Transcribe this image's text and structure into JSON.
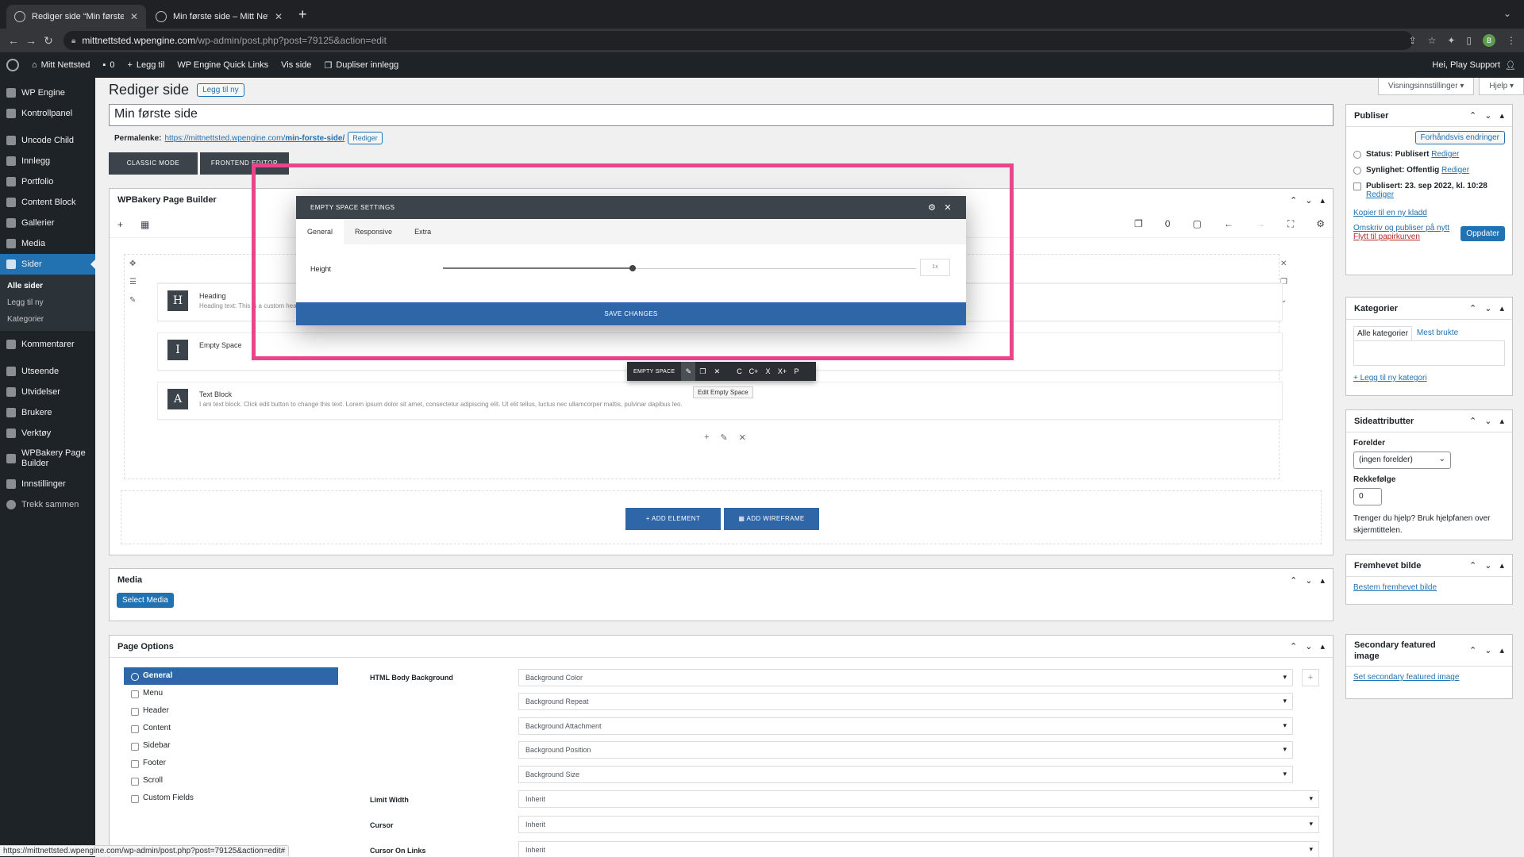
{
  "browser": {
    "tabs": [
      {
        "label": "Rediger side “Min første side”"
      },
      {
        "label": "Min første side – Mitt Nettsted"
      }
    ],
    "url_host": "mittnettsted.wpengine.com",
    "url_path": "/wp-admin/post.php?post=79125&action=edit",
    "profile_initial": "B"
  },
  "adminbar": {
    "site": "Mitt Nettsted",
    "comments": "0",
    "new": "Legg til",
    "quicklinks": "WP Engine Quick Links",
    "view": "Vis side",
    "duplicate": "Dupliser innlegg",
    "greeting": "Hei, Play Support"
  },
  "sidebar": {
    "items": [
      {
        "label": "WP Engine"
      },
      {
        "label": "Kontrollpanel"
      },
      {
        "label": "Uncode Child"
      },
      {
        "label": "Innlegg"
      },
      {
        "label": "Portfolio"
      },
      {
        "label": "Content Block"
      },
      {
        "label": "Gallerier"
      },
      {
        "label": "Media"
      },
      {
        "label": "Sider"
      }
    ],
    "sub": [
      "Alle sider",
      "Legg til ny",
      "Kategorier"
    ],
    "items2": [
      {
        "label": "Kommentarer"
      },
      {
        "label": "Utseende"
      },
      {
        "label": "Utvidelser"
      },
      {
        "label": "Brukere"
      },
      {
        "label": "Verktøy"
      },
      {
        "label": "WPBakery Page Builder"
      },
      {
        "label": "Innstillinger"
      },
      {
        "label": "Trekk sammen"
      }
    ]
  },
  "header": {
    "title": "Rediger side",
    "add_new": "Legg til ny",
    "screen_options": "Visningsinnstillinger",
    "help": "Hjelp"
  },
  "post": {
    "title": "Min første side",
    "permalink_label": "Permalenke:",
    "permalink_base": "https://mittnettsted.wpengine.com/",
    "permalink_slug": "min-forste-side/",
    "edit": "Rediger"
  },
  "modes": {
    "classic": "CLASSIC MODE",
    "frontend": "FRONTEND EDITOR"
  },
  "wpbakery": {
    "title": "WPBakery Page Builder",
    "counter": "0",
    "elements": [
      {
        "icon": "H",
        "title": "Heading",
        "desc": "Heading text: This is a custom heading element."
      },
      {
        "icon": "I",
        "title": "Empty Space",
        "desc": ""
      },
      {
        "icon": "A",
        "title": "Text Block",
        "desc": "I am text block. Click edit button to change this text. Lorem ipsum dolor sit amet, consectetur adipiscing elit. Ut elit tellus, luctus nec ullamcorper mattis, pulvinar dapibus leo."
      }
    ],
    "add_element": "ADD ELEMENT",
    "add_wireframe": "ADD WIREFRAME"
  },
  "modal": {
    "title": "EMPTY SPACE SETTINGS",
    "tabs": [
      "General",
      "Responsive",
      "Extra"
    ],
    "height_label": "Height",
    "height_value": "1x",
    "save": "SAVE CHANGES"
  },
  "element_toolbar": {
    "label": "EMPTY SPACE",
    "size_buttons": [
      "C",
      "C+",
      "X",
      "X+",
      "P"
    ],
    "tooltip": "Edit Empty Space"
  },
  "media": {
    "title": "Media",
    "button": "Select Media"
  },
  "page_options": {
    "title": "Page Options",
    "nav": [
      "General",
      "Menu",
      "Header",
      "Content",
      "Sidebar",
      "Footer",
      "Scroll",
      "Custom Fields"
    ],
    "body_bg_label": "HTML Body Background",
    "bg_selects": [
      "Background Color",
      "Background Repeat",
      "Background Attachment",
      "Background Position",
      "Background Size"
    ],
    "limit_width_label": "Limit Width",
    "limit_width_value": "Inherit",
    "cursor_label": "Cursor",
    "cursor_value": "Inherit",
    "cursor_links_label": "Cursor On Links",
    "cursor_links_value": "Inherit"
  },
  "publish": {
    "title": "Publiser",
    "preview": "Forhåndsvis endringer",
    "status": "Status: Publisert",
    "visibility": "Synlighet: Offentlig",
    "published": "Publisert: 23. sep 2022, kl. 10:28",
    "edit": "Rediger",
    "copy_draft": "Kopier til en ny kladd",
    "rewrite": "Omskriv og publiser på nytt",
    "trash": "Flytt til papirkurven",
    "update": "Oppdater"
  },
  "categories": {
    "title": "Kategorier",
    "tab_all": "Alle kategorier",
    "tab_most": "Mest brukte",
    "add": "+ Legg til ny kategori"
  },
  "attributes": {
    "title": "Sideattributter",
    "parent_label": "Forelder",
    "parent_value": "(ingen forelder)",
    "order_label": "Rekkefølge",
    "order_value": "0",
    "help": "Trenger du hjelp? Bruk hjelpfanen over skjermtittelen."
  },
  "featured": {
    "title": "Fremhevet bilde",
    "link": "Bestem fremhevet bilde"
  },
  "secondary": {
    "title": "Secondary featured image",
    "link": "Set secondary featured image"
  },
  "status_url": "https://mittnettsted.wpengine.com/wp-admin/post.php?post=79125&action=edit#"
}
